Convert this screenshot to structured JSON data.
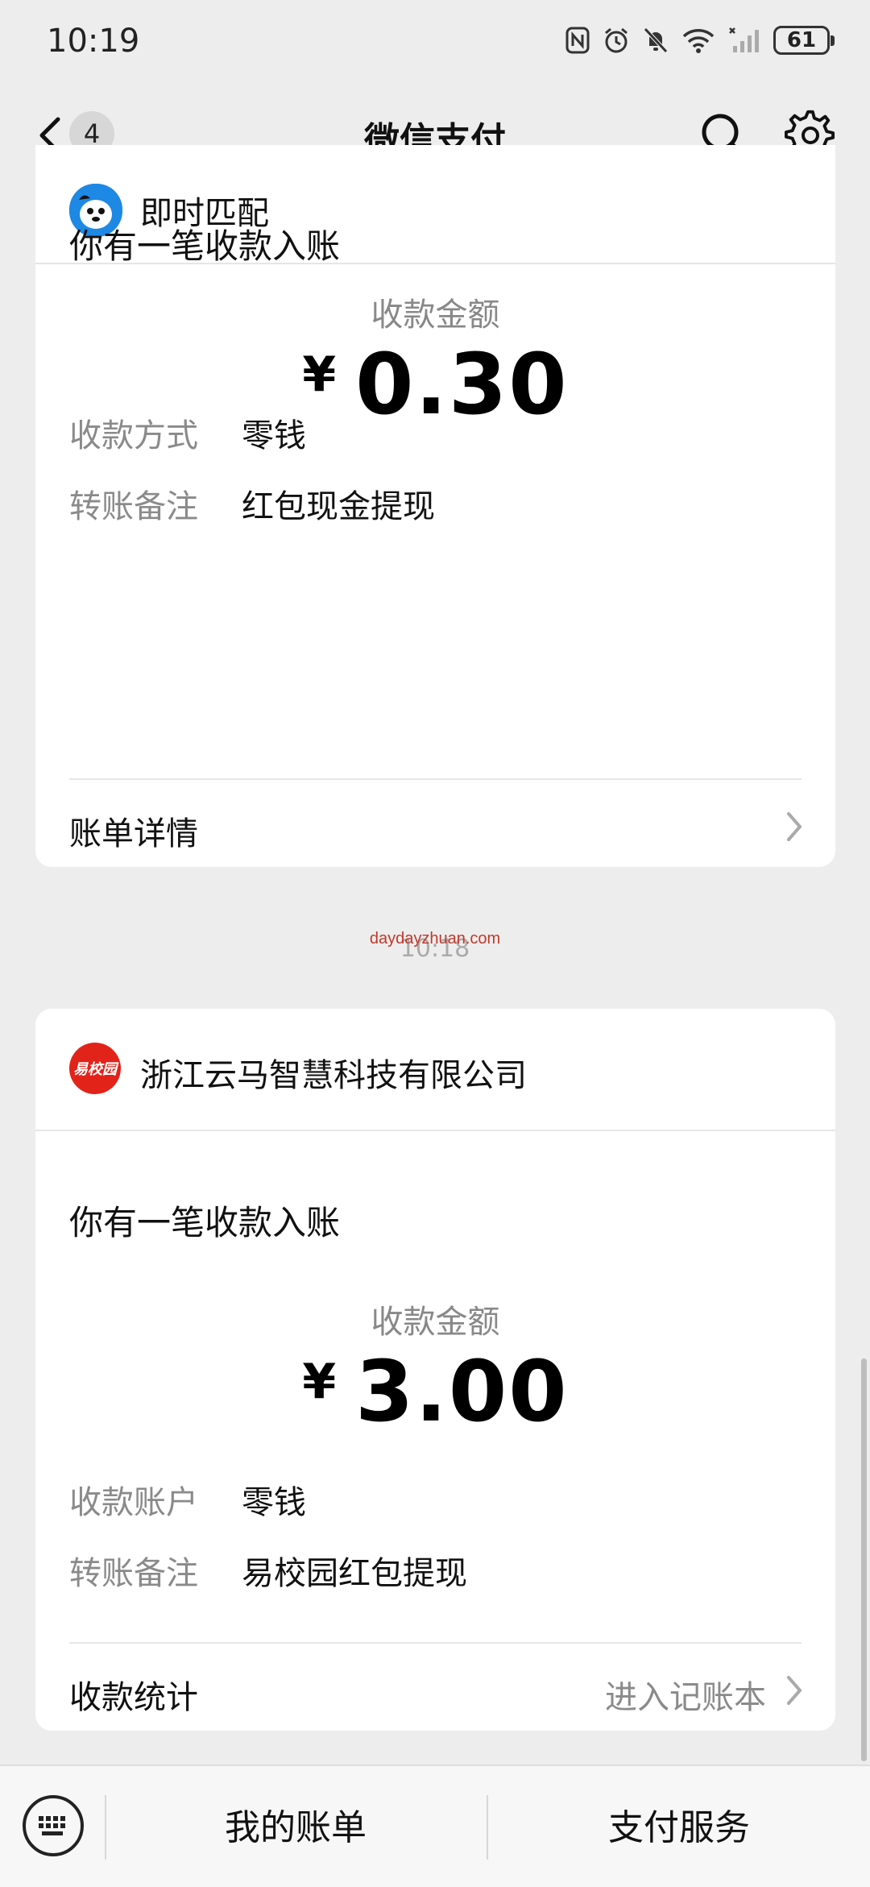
{
  "status_bar": {
    "time": "10:19",
    "battery": "61"
  },
  "nav": {
    "back_count": "4",
    "title": "微信支付"
  },
  "cards": [
    {
      "merchant": "即时匹配",
      "title": "你有一笔收款入账",
      "amount_label": "收款金额",
      "currency": "¥",
      "amount": "0.30",
      "rows": [
        {
          "key": "收款方式",
          "value": "零钱"
        },
        {
          "key": "转账备注",
          "value": "红包现金提现"
        }
      ],
      "footer_label": "账单详情",
      "footer_right": ""
    },
    {
      "merchant": "浙江云马智慧科技有限公司",
      "logo_text": "易校园",
      "title": "你有一笔收款入账",
      "amount_label": "收款金额",
      "currency": "¥",
      "amount": "3.00",
      "rows": [
        {
          "key": "收款账户",
          "value": "零钱"
        },
        {
          "key": "转账备注",
          "value": "易校园红包提现"
        }
      ],
      "footer_label": "收款统计",
      "footer_right": "进入记账本"
    }
  ],
  "time_separator": "10:18",
  "watermark": "daydayzhuan.com",
  "bottom_bar": {
    "tab1": "我的账单",
    "tab2": "支付服务"
  },
  "colors": {
    "background": "#ededed",
    "card": "#ffffff",
    "accent_red": "#e2231a"
  }
}
